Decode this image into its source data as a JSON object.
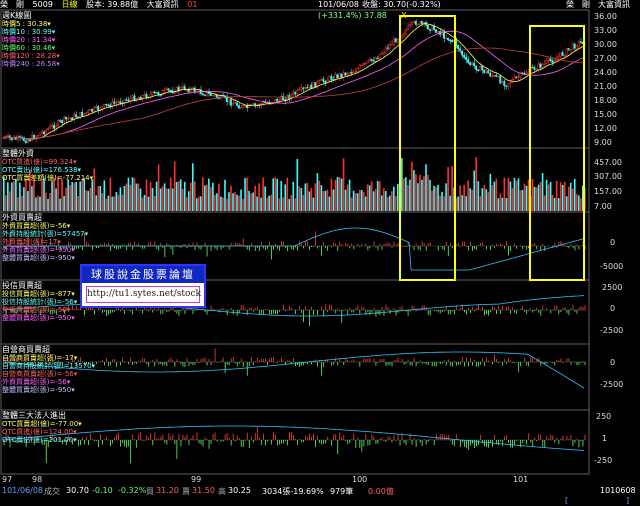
{
  "header": {
    "stock_name": "榮　剛",
    "stock_code": "5009",
    "period": "日線",
    "capital": "股本: 39.88億",
    "brand": "大富資訊",
    "flag": "01",
    "date_label": "101/06/08",
    "close_label": "收盤: 30.70(-0.32%)",
    "right_name": "榮　剛",
    "right_brand": "大富資訊"
  },
  "panes": {
    "price": {
      "title": "週K線圖",
      "legend": [
        "時價5 : 30.38▾",
        "時價10 : 30.99▾",
        "時價20 : 31.34▾",
        "時價60 : 30.46▾",
        "時價120 : 28.28▾",
        "時價240 : 26.58▾"
      ],
      "peak_label": "(+331.4%) 37.88",
      "axis": [
        "36.00",
        "33.00",
        "30.00",
        "27.00",
        "24.00",
        "21.00",
        "18.00",
        "15.00",
        "12.00",
        "9.00"
      ]
    },
    "volume": {
      "title": "整體外資",
      "legend": [
        "OTC買進(億)=99.324▾",
        "OTC賣出(億)=176.538▾",
        "OTC買賣差額(億)=-77.214▾"
      ],
      "axis": [
        "457.00",
        "307.00",
        "157.00",
        "7.00"
      ]
    },
    "foreign": {
      "title": "外資買賣超",
      "legend": [
        "外資買賣超(張)=-56▾",
        "外資持股統計(張)=57457▾",
        "外資賣超(張)=17▾",
        "外資買賣超(張)=-950▾",
        "整體買賣超(張)=-950▾"
      ],
      "axis": [
        "0",
        "-5000"
      ]
    },
    "trust": {
      "title": "投信買賣超",
      "legend": [
        "投信買賣超(張)=-877▾",
        "投信持股統計(張)=-56▾",
        "外資買賣超(張)=-56▾",
        "整體買賣超(張)=-950▾"
      ],
      "axis": [
        "2500",
        "0",
        "-2500"
      ]
    },
    "dealer": {
      "title": "自營商買賣超",
      "legend": [
        "自營商買賣超(張)=-17▾",
        "自營商持股統計(張)=13570▾",
        "自營商買賣超(張)=-56▾",
        "外資買賣超(張)=-56▾",
        "整體買賣超(張)=-950▾"
      ],
      "axis": [
        "0",
        "-2500"
      ]
    },
    "total": {
      "title": "整體三大法人進出",
      "legend": [
        "OTC買賣超(億)=-77.00▾",
        "OTC買進(億)=124.00▾",
        "OTC賣出(億)=201.00▾"
      ],
      "axis": [
        "250",
        "1",
        "-250"
      ]
    }
  },
  "watermark": {
    "title": "球股說金股票論壇",
    "url": "http://tu1.sytes.net/stock"
  },
  "xaxis": [
    "97",
    "98",
    "99",
    "100",
    "101"
  ],
  "status": {
    "date": "101/06/08",
    "price_lbl": "成交",
    "price": "30.70",
    "change": "-0.10",
    "pct": "-0.32%",
    "bid_lbl": "買",
    "bid": "31.20",
    "ask_lbl": "賣",
    "ask": "31.50",
    "high_lbl": "高",
    "high": "30.25",
    "vol": "3034張-19.69%",
    "count": "979筆",
    "extra": "0.00億",
    "right_date": "1010608"
  },
  "colors": {
    "bg": "#000000",
    "up": "#ff3030",
    "down": "#30ffff",
    "highlight": "#ffff00",
    "grid": "#404040"
  }
}
